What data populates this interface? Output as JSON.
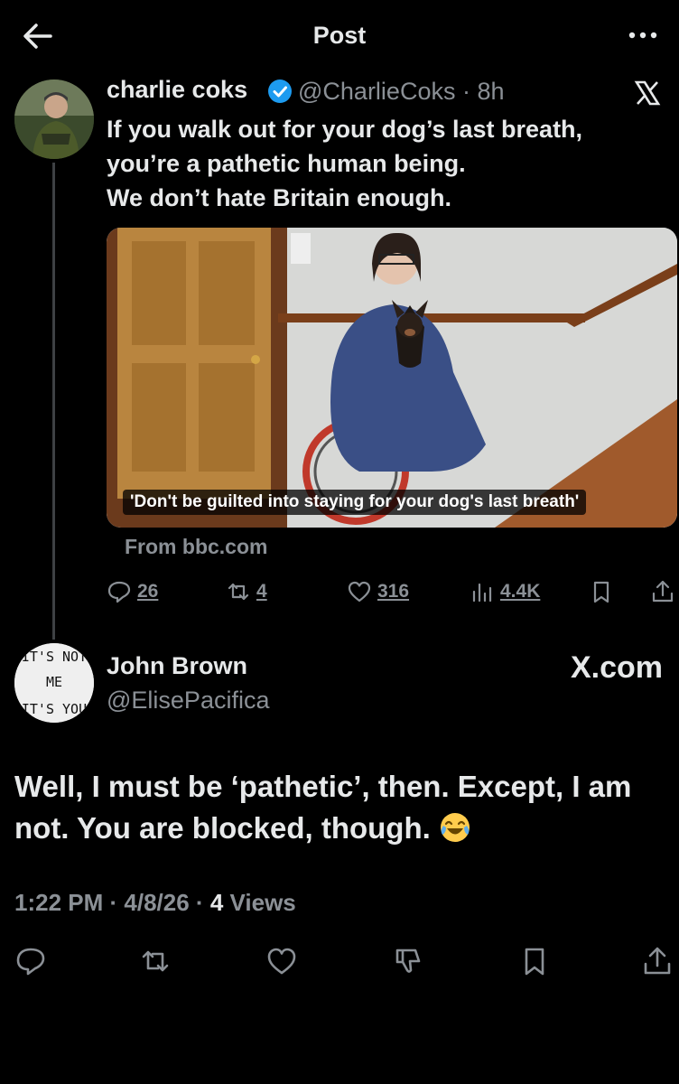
{
  "header": {
    "title": "Post"
  },
  "original_post": {
    "display_name": "charlie coks",
    "handle": "@CharlieCoks",
    "time": "· 8h",
    "text_lines": [
      "If you walk out for your dog’s last breath,",
      "you’re a pathetic human being.",
      "We don’t hate Britain enough."
    ],
    "media_caption": "'Don't be guilted into staying for your dog's last breath'",
    "media_source": "From bbc.com",
    "replies": "26",
    "reposts": "4",
    "likes": "316",
    "views": "4.4K"
  },
  "reply_post": {
    "display_name": "John Brown",
    "handle": "@ElisePacifica",
    "badge": "X.com",
    "avatar_text": [
      "IT'S NOT",
      "ME",
      "IT'S YOU"
    ],
    "text": "Well, I must be ‘pathetic’, then. Except, I am not. You are blocked, though.",
    "time": "1:22 PM",
    "date": "4/8/26",
    "views_count": "4",
    "views_label": "Views"
  },
  "colors": {
    "background": "#000000",
    "text": "#e7e9ea",
    "muted": "#8b9096",
    "verified": "#1d9bf0"
  }
}
